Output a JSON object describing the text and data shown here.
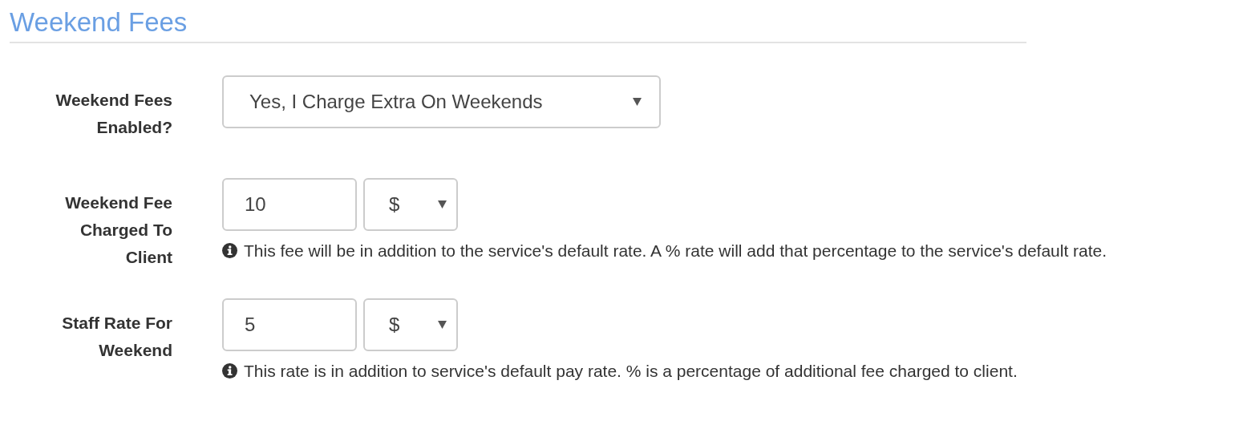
{
  "heading": "Weekend Fees",
  "fields": [
    {
      "kind": "select",
      "label": "Weekend Fees Enabled?",
      "value": "Yes, I Charge Extra On Weekends"
    },
    {
      "kind": "amount",
      "label": "Weekend Fee Charged To Client",
      "value": "10",
      "unit": "$",
      "help": "This fee will be in addition to the service's default rate. A % rate will add that percentage to the service's default rate."
    },
    {
      "kind": "amount",
      "label": "Staff Rate For Weekend",
      "value": "5",
      "unit": "$",
      "help": "This rate is in addition to service's default pay rate. % is a percentage of additional fee charged to client."
    }
  ]
}
